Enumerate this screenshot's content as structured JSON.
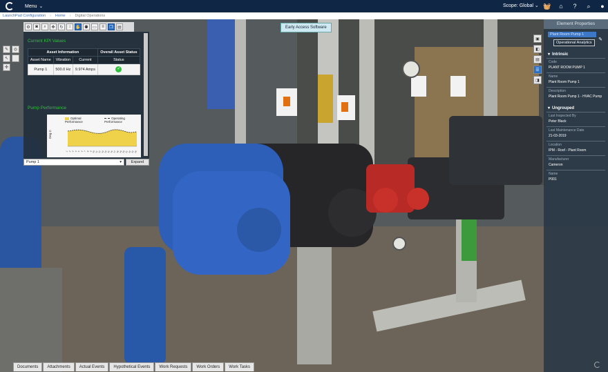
{
  "topbar": {
    "menu_label": "Menu",
    "scope_label": "Scope: Global"
  },
  "breadcrumb": {
    "items": [
      "LaunchPad Configuration",
      "Home",
      "Digital Operations"
    ]
  },
  "viewer": {
    "early_access": "Early Access Software"
  },
  "panel": {
    "title": "Current KPI Values",
    "table": {
      "group_headers": [
        "Asset Information",
        "Overall Asset Status"
      ],
      "columns": [
        "Asset Name",
        "Vibration",
        "Current",
        "Status"
      ],
      "rows": [
        {
          "name": "Pump 1",
          "vibration": "500.0 Hz",
          "current": "9.974 Amps",
          "status": "ok"
        }
      ]
    },
    "perf_title": "Pump Performance",
    "chart": {
      "legend_optimal": "Optimal Performance",
      "legend_operating": "Operating Performance",
      "ylabel": "Deg C",
      "xticks": [
        "1",
        "2",
        "3",
        "4",
        "5",
        "6",
        "7",
        "8",
        "9",
        "10",
        "11",
        "12",
        "13",
        "14",
        "15",
        "16",
        "17",
        "18",
        "19",
        "20",
        "21",
        "22",
        "23",
        "24"
      ]
    },
    "select_value": "Pump 1",
    "expand_label": "Expand"
  },
  "chart_data": {
    "type": "area",
    "title": "Pump Performance",
    "ylabel": "Deg C",
    "x": [
      1,
      2,
      3,
      4,
      5,
      6,
      7,
      8,
      9,
      10,
      11,
      12,
      13,
      14,
      15,
      16,
      17,
      18,
      19,
      20,
      21,
      22,
      23,
      24
    ],
    "series": [
      {
        "name": "Optimal Performance",
        "values": [
          6,
          6,
          6,
          6,
          6,
          6,
          6,
          6,
          6,
          6,
          6,
          6,
          6,
          6,
          6,
          6,
          6,
          6,
          6,
          6,
          6,
          6,
          6,
          6
        ]
      },
      {
        "name": "Operating Performance",
        "values": [
          5.2,
          5.3,
          5.5,
          5.6,
          5.6,
          5.5,
          5.3,
          5.0,
          4.7,
          4.5,
          4.4,
          4.4,
          4.6,
          4.9,
          5.3,
          5.6,
          5.7,
          5.6,
          5.4,
          5.1,
          4.8,
          4.7,
          4.8,
          5.0
        ]
      }
    ],
    "ylim": [
      0,
      8
    ]
  },
  "properties": {
    "header": "Element Properties",
    "element_name": "Plant Room Pump 1",
    "op_button": "Operational Analytics",
    "intrinsic_label": "Intrinsic",
    "intrinsic": [
      {
        "label": "Code",
        "value": "PLANT ROOM PUMP 1"
      },
      {
        "label": "Name",
        "value": "Plant Room Pump 1"
      },
      {
        "label": "Description",
        "value": "Plant Room Pump 1 - HVAC Pump"
      }
    ],
    "ungrouped_label": "Ungrouped",
    "ungrouped": [
      {
        "label": "Last Inspected By",
        "value": "Peter Black"
      },
      {
        "label": "Last Maintenance Date",
        "value": "21-03-2019"
      },
      {
        "label": "Location",
        "value": "IPM - Roof - Plant Room"
      },
      {
        "label": "Manufacturer",
        "value": "Cameron"
      },
      {
        "label": "Name",
        "value": "P001"
      }
    ]
  },
  "tabs": [
    "Documents",
    "Attachments",
    "Actual Events",
    "Hypothetical Events",
    "Work Requests",
    "Work Orders",
    "Work Tasks"
  ],
  "colors": {
    "navy": "#0f2744",
    "accent": "#2b6fc4",
    "kpi_green": "#2ec23a",
    "optimal_fill": "#f0d24a"
  }
}
